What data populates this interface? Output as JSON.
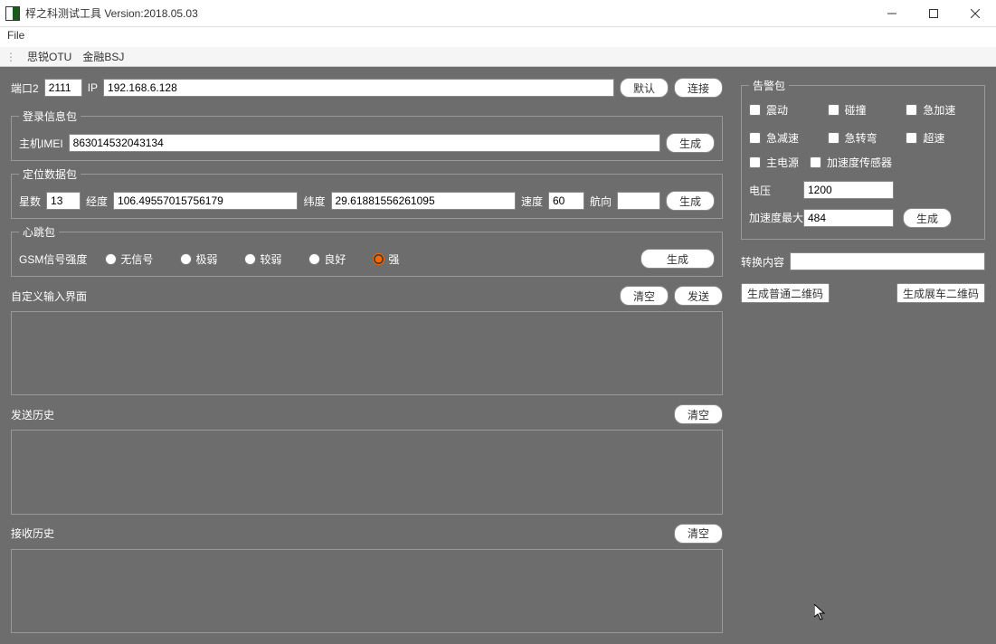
{
  "window": {
    "title": "桴之科测试工具 Version:2018.05.03"
  },
  "menu": {
    "file": "File"
  },
  "toolbar": {
    "tab1": "思锐OTU",
    "tab2": "金融BSJ"
  },
  "conn": {
    "port_label": "端口2",
    "port_value": "2111",
    "ip_label": "IP",
    "ip_value": "192.168.6.128",
    "default_btn": "默认",
    "connect_btn": "连接"
  },
  "login": {
    "legend": "登录信息包",
    "imei_label": "主机IMEI",
    "imei_value": "863014532043134",
    "gen_btn": "生成"
  },
  "locate": {
    "legend": "定位数据包",
    "sat_label": "星数",
    "sat_value": "13",
    "lon_label": "经度",
    "lon_value": "106.49557015756179",
    "lat_label": "纬度",
    "lat_value": "29.61881556261095",
    "speed_label": "速度",
    "speed_value": "60",
    "heading_label": "航向",
    "heading_value": "",
    "gen_btn": "生成"
  },
  "heartbeat": {
    "legend": "心跳包",
    "gsm_label": "GSM信号强度",
    "opt_none": "无信号",
    "opt_veryweak": "极弱",
    "opt_weak": "较弱",
    "opt_good": "良好",
    "opt_strong": "强",
    "gen_btn": "生成"
  },
  "custom": {
    "label": "自定义输入界面",
    "clear_btn": "清空",
    "send_btn": "发送"
  },
  "send_history": {
    "label": "发送历史",
    "clear_btn": "清空"
  },
  "recv_history": {
    "label": "接收历史",
    "clear_btn": "清空"
  },
  "alarm": {
    "legend": "告警包",
    "vibration": "震动",
    "collision": "碰撞",
    "accel": "急加速",
    "decel": "急减速",
    "turn": "急转弯",
    "overspeed": "超速",
    "main_power": "主电源",
    "accel_sensor": "加速度传感器",
    "voltage_label": "电压",
    "voltage_value": "1200",
    "acc_diff_label": "加速度最大差值",
    "acc_diff_value": "484",
    "gen_btn": "生成"
  },
  "convert": {
    "label": "转换内容",
    "value": "",
    "gen_normal_qr": "生成普通二维码",
    "gen_display_qr": "生成展车二维码"
  }
}
